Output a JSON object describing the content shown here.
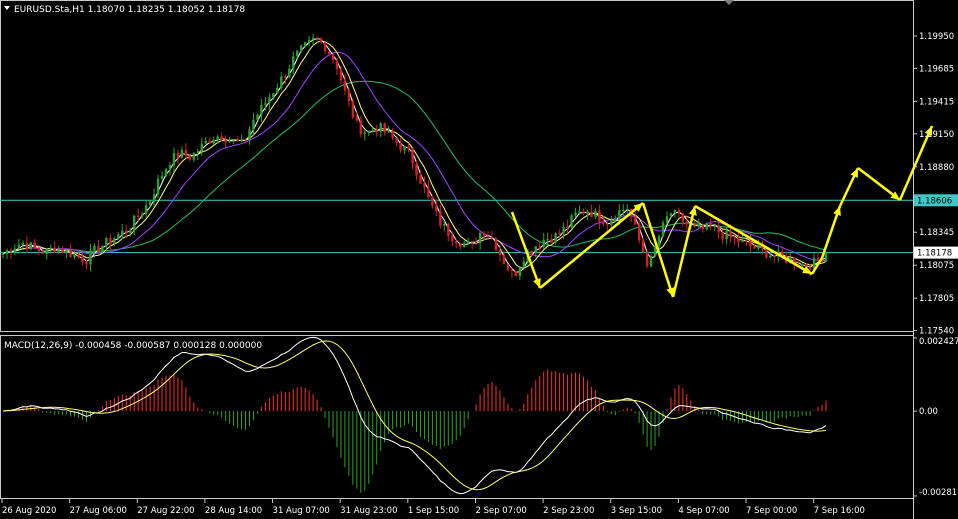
{
  "window": {
    "symbol_line": "EURUSD.Sta,H1  1.18070 1.18235 1.18052 1.18178"
  },
  "colors": {
    "background": "#000000",
    "frame": "#c8c8c8",
    "bull_candle": "#2ea02e",
    "bear_candle": "#d42020",
    "ma_fast": "#ffffff",
    "ma_mid": "#ffff80",
    "ma_purple": "#a040ff",
    "ma_slow": "#20c060",
    "hline": "#40c8c8",
    "arrow": "#ffff00",
    "macd_pos": "#ff3030",
    "macd_neg": "#2ea02e"
  },
  "chart_data": [
    {
      "type": "candlestick",
      "title": "EURUSD.Sta,H1",
      "ohlc_readout": {
        "open": 1.1807,
        "high": 1.18235,
        "low": 1.18052,
        "close": 1.18178
      },
      "ylim": [
        1.17545,
        1.20228
      ],
      "y_ticks": [
        "1.19950",
        "1.19685",
        "1.19415",
        "1.19150",
        "1.18880",
        "1.18345",
        "1.18075",
        "1.17805",
        "1.17540"
      ],
      "x_ticks": [
        "26 Aug 2020",
        "27 Aug 06:00",
        "27 Aug 22:00",
        "28 Aug 14:00",
        "31 Aug 07:00",
        "31 Aug 23:00",
        "1 Sep 15:00",
        "2 Sep 07:00",
        "2 Sep 23:00",
        "3 Sep 15:00",
        "4 Sep 07:00",
        "7 Sep 00:00",
        "7 Sep 16:00"
      ],
      "hlines": [
        {
          "value": 1.18606,
          "label": "1.18606",
          "boxed": true
        },
        {
          "value": 1.18178,
          "label": "1.18178",
          "boxed": false
        }
      ],
      "closing_price_series": [
        1.1817,
        1.1823,
        1.1826,
        1.1821,
        1.1818,
        1.1822,
        1.1819,
        1.1815,
        1.1812,
        1.1821,
        1.1826,
        1.1832,
        1.1837,
        1.1848,
        1.1859,
        1.1878,
        1.1893,
        1.1899,
        1.1896,
        1.1904,
        1.1912,
        1.1914,
        1.1909,
        1.1906,
        1.1926,
        1.1938,
        1.1951,
        1.1963,
        1.1978,
        1.1986,
        1.1993,
        1.1986,
        1.1972,
        1.1944,
        1.1921,
        1.1916,
        1.1921,
        1.1914,
        1.1906,
        1.1899,
        1.1879,
        1.1858,
        1.1842,
        1.1832,
        1.1826,
        1.1823,
        1.1837,
        1.1829,
        1.1812,
        1.1798,
        1.1815,
        1.1823,
        1.1829,
        1.1831,
        1.1838,
        1.1849,
        1.1853,
        1.1848,
        1.1843,
        1.1851,
        1.1855,
        1.1829,
        1.1806,
        1.1832,
        1.1851,
        1.1846,
        1.1838,
        1.1836,
        1.1839,
        1.1833,
        1.1829,
        1.1826,
        1.1822,
        1.1819,
        1.1815,
        1.1813,
        1.1811,
        1.1807,
        1.181,
        1.1818
      ],
      "arrows_drawn": "yellow zig-zag projection arrows"
    },
    {
      "type": "macd",
      "label": "MACD(12,26,9) -0.000458 -0.000587 0.000128 0.000000",
      "params": [
        12,
        26,
        9
      ],
      "values": {
        "macd": -0.000458,
        "signal": -0.000587,
        "hist": 0.000128,
        "zero": 0.0
      },
      "ylim": [
        -0.002818,
        0.002427
      ],
      "y_ticks": [
        "0.002427",
        "0.00",
        "-0.002818"
      ]
    }
  ]
}
